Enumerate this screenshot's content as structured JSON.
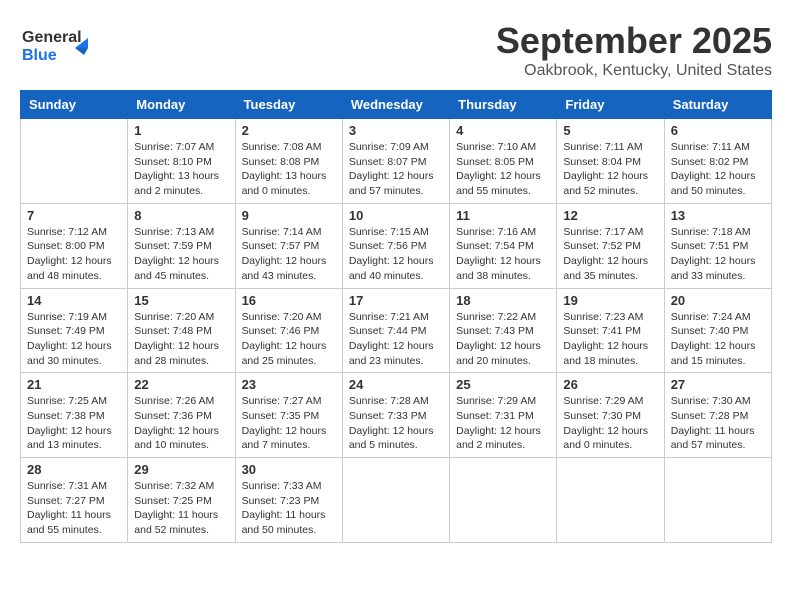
{
  "header": {
    "logo_line1": "General",
    "logo_line2": "Blue",
    "month": "September 2025",
    "location": "Oakbrook, Kentucky, United States"
  },
  "weekdays": [
    "Sunday",
    "Monday",
    "Tuesday",
    "Wednesday",
    "Thursday",
    "Friday",
    "Saturday"
  ],
  "weeks": [
    [
      {
        "day": "",
        "info": ""
      },
      {
        "day": "1",
        "info": "Sunrise: 7:07 AM\nSunset: 8:10 PM\nDaylight: 13 hours\nand 2 minutes."
      },
      {
        "day": "2",
        "info": "Sunrise: 7:08 AM\nSunset: 8:08 PM\nDaylight: 13 hours\nand 0 minutes."
      },
      {
        "day": "3",
        "info": "Sunrise: 7:09 AM\nSunset: 8:07 PM\nDaylight: 12 hours\nand 57 minutes."
      },
      {
        "day": "4",
        "info": "Sunrise: 7:10 AM\nSunset: 8:05 PM\nDaylight: 12 hours\nand 55 minutes."
      },
      {
        "day": "5",
        "info": "Sunrise: 7:11 AM\nSunset: 8:04 PM\nDaylight: 12 hours\nand 52 minutes."
      },
      {
        "day": "6",
        "info": "Sunrise: 7:11 AM\nSunset: 8:02 PM\nDaylight: 12 hours\nand 50 minutes."
      }
    ],
    [
      {
        "day": "7",
        "info": "Sunrise: 7:12 AM\nSunset: 8:00 PM\nDaylight: 12 hours\nand 48 minutes."
      },
      {
        "day": "8",
        "info": "Sunrise: 7:13 AM\nSunset: 7:59 PM\nDaylight: 12 hours\nand 45 minutes."
      },
      {
        "day": "9",
        "info": "Sunrise: 7:14 AM\nSunset: 7:57 PM\nDaylight: 12 hours\nand 43 minutes."
      },
      {
        "day": "10",
        "info": "Sunrise: 7:15 AM\nSunset: 7:56 PM\nDaylight: 12 hours\nand 40 minutes."
      },
      {
        "day": "11",
        "info": "Sunrise: 7:16 AM\nSunset: 7:54 PM\nDaylight: 12 hours\nand 38 minutes."
      },
      {
        "day": "12",
        "info": "Sunrise: 7:17 AM\nSunset: 7:52 PM\nDaylight: 12 hours\nand 35 minutes."
      },
      {
        "day": "13",
        "info": "Sunrise: 7:18 AM\nSunset: 7:51 PM\nDaylight: 12 hours\nand 33 minutes."
      }
    ],
    [
      {
        "day": "14",
        "info": "Sunrise: 7:19 AM\nSunset: 7:49 PM\nDaylight: 12 hours\nand 30 minutes."
      },
      {
        "day": "15",
        "info": "Sunrise: 7:20 AM\nSunset: 7:48 PM\nDaylight: 12 hours\nand 28 minutes."
      },
      {
        "day": "16",
        "info": "Sunrise: 7:20 AM\nSunset: 7:46 PM\nDaylight: 12 hours\nand 25 minutes."
      },
      {
        "day": "17",
        "info": "Sunrise: 7:21 AM\nSunset: 7:44 PM\nDaylight: 12 hours\nand 23 minutes."
      },
      {
        "day": "18",
        "info": "Sunrise: 7:22 AM\nSunset: 7:43 PM\nDaylight: 12 hours\nand 20 minutes."
      },
      {
        "day": "19",
        "info": "Sunrise: 7:23 AM\nSunset: 7:41 PM\nDaylight: 12 hours\nand 18 minutes."
      },
      {
        "day": "20",
        "info": "Sunrise: 7:24 AM\nSunset: 7:40 PM\nDaylight: 12 hours\nand 15 minutes."
      }
    ],
    [
      {
        "day": "21",
        "info": "Sunrise: 7:25 AM\nSunset: 7:38 PM\nDaylight: 12 hours\nand 13 minutes."
      },
      {
        "day": "22",
        "info": "Sunrise: 7:26 AM\nSunset: 7:36 PM\nDaylight: 12 hours\nand 10 minutes."
      },
      {
        "day": "23",
        "info": "Sunrise: 7:27 AM\nSunset: 7:35 PM\nDaylight: 12 hours\nand 7 minutes."
      },
      {
        "day": "24",
        "info": "Sunrise: 7:28 AM\nSunset: 7:33 PM\nDaylight: 12 hours\nand 5 minutes."
      },
      {
        "day": "25",
        "info": "Sunrise: 7:29 AM\nSunset: 7:31 PM\nDaylight: 12 hours\nand 2 minutes."
      },
      {
        "day": "26",
        "info": "Sunrise: 7:29 AM\nSunset: 7:30 PM\nDaylight: 12 hours\nand 0 minutes."
      },
      {
        "day": "27",
        "info": "Sunrise: 7:30 AM\nSunset: 7:28 PM\nDaylight: 11 hours\nand 57 minutes."
      }
    ],
    [
      {
        "day": "28",
        "info": "Sunrise: 7:31 AM\nSunset: 7:27 PM\nDaylight: 11 hours\nand 55 minutes."
      },
      {
        "day": "29",
        "info": "Sunrise: 7:32 AM\nSunset: 7:25 PM\nDaylight: 11 hours\nand 52 minutes."
      },
      {
        "day": "30",
        "info": "Sunrise: 7:33 AM\nSunset: 7:23 PM\nDaylight: 11 hours\nand 50 minutes."
      },
      {
        "day": "",
        "info": ""
      },
      {
        "day": "",
        "info": ""
      },
      {
        "day": "",
        "info": ""
      },
      {
        "day": "",
        "info": ""
      }
    ]
  ]
}
